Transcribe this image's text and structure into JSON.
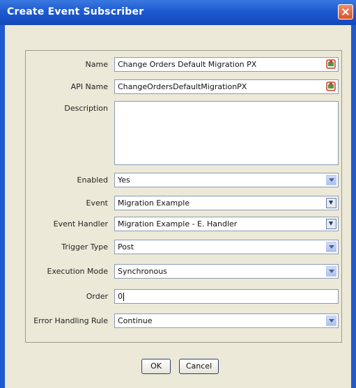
{
  "window": {
    "title": "Create Event Subscriber",
    "close_icon": "close-icon"
  },
  "form": {
    "name_label": "Name",
    "name_value": "Change Orders Default Migration PX",
    "api_name_label": "API Name",
    "api_name_value": "ChangeOrdersDefaultMigrationPX",
    "description_label": "Description",
    "description_value": "",
    "enabled_label": "Enabled",
    "enabled_value": "Yes",
    "event_label": "Event",
    "event_value": "Migration Example",
    "event_handler_label": "Event Handler",
    "event_handler_value": "Migration Example - E. Handler",
    "trigger_type_label": "Trigger Type",
    "trigger_type_value": "Post",
    "execution_mode_label": "Execution Mode",
    "execution_mode_value": "Synchronous",
    "order_label": "Order",
    "order_value": "0",
    "error_handling_label": "Error Handling Rule",
    "error_handling_value": "Continue"
  },
  "buttons": {
    "ok": "OK",
    "cancel": "Cancel"
  },
  "icons": {
    "multilang": "translate-icon",
    "dropdown": "chevron-down-icon",
    "lookup": "lookup-icon"
  },
  "colors": {
    "titlebar": "#1d5ad2",
    "window_bg": "#ece9d8",
    "close_button": "#d8532c"
  }
}
